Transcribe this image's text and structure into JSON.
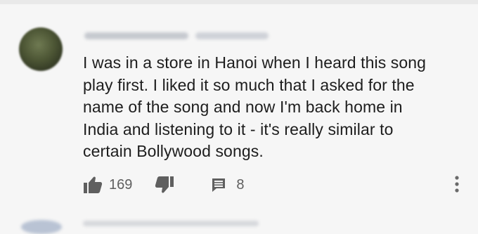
{
  "comment": {
    "author": "",
    "timestamp": "",
    "text": "I was in a store in Hanoi when I heard this song\nplay first. I liked it so much that I asked for the\nname of the song and now I'm back home in\nIndia and listening to it - it's really similar to\ncertain Bollywood songs.",
    "like_count": "169",
    "reply_count": "8"
  },
  "icons": {
    "like": "thumbs-up-icon",
    "dislike": "thumbs-down-icon",
    "reply": "comment-icon",
    "more": "more-vert-icon"
  },
  "colors": {
    "background": "#f6f6f6",
    "text": "#1d1d1d",
    "secondary": "#5f5f5f"
  }
}
